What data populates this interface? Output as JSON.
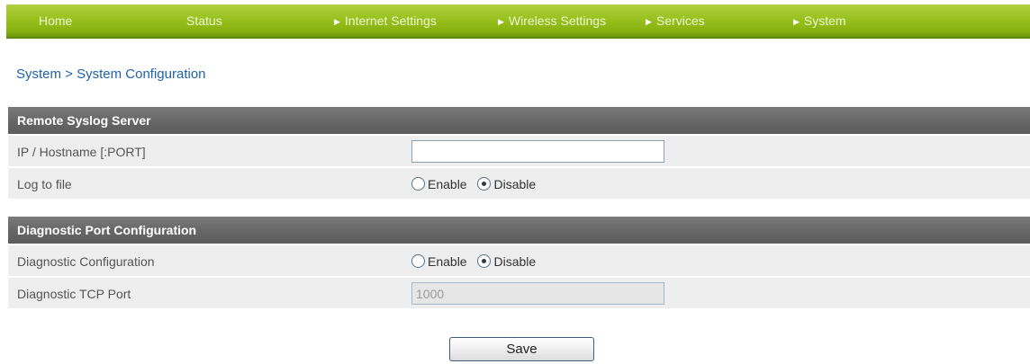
{
  "nav": {
    "items": [
      {
        "label": "Home",
        "arrow": false
      },
      {
        "label": "Status",
        "arrow": false
      },
      {
        "label": "Internet Settings",
        "arrow": true
      },
      {
        "label": "Wireless Settings",
        "arrow": true
      },
      {
        "label": "Services",
        "arrow": true
      },
      {
        "label": "System",
        "arrow": true
      }
    ],
    "arrow_glyph": "▶"
  },
  "breadcrumb": "System > System Configuration",
  "syslog": {
    "header": "Remote Syslog Server",
    "host_label": "IP / Hostname [:PORT]",
    "host_value": "",
    "log_label": "Log to file",
    "log_enable": "Enable",
    "log_disable": "Disable",
    "log_selected": "Disable"
  },
  "diag": {
    "header": "Diagnostic Port Configuration",
    "config_label": "Diagnostic Configuration",
    "config_enable": "Enable",
    "config_disable": "Disable",
    "config_selected": "Disable",
    "port_label": "Diagnostic TCP Port",
    "port_value": "1000"
  },
  "save_label": "Save",
  "colors": {
    "nav_green": "#98c11e",
    "header_gray": "#666666",
    "row_bg": "#eeeeee",
    "link_blue": "#1d63a8"
  }
}
